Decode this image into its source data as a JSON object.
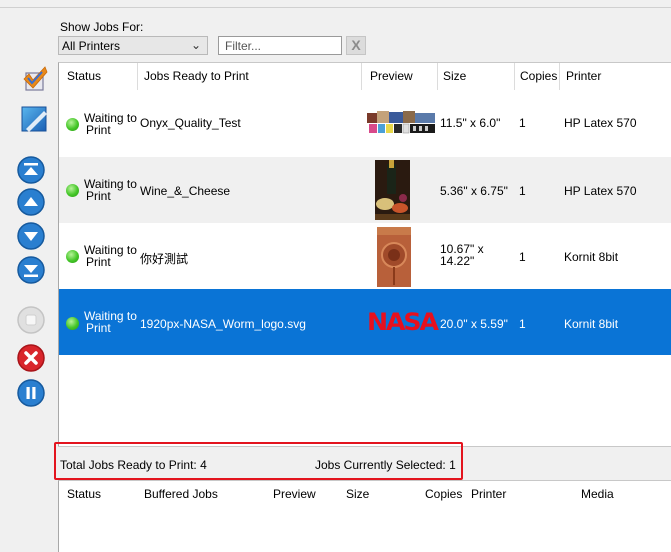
{
  "filter_bar": {
    "show_jobs_label": "Show Jobs For:",
    "printer_selected": "All Printers",
    "filter_placeholder": "Filter...",
    "clear_label": "X"
  },
  "jobs_table": {
    "columns": [
      "Status",
      "Jobs Ready to Print",
      "Preview",
      "Size",
      "Copies",
      "Printer"
    ],
    "rows": [
      {
        "status_line1": "Waiting to",
        "status_line2": "Print",
        "name": "Onyx_Quality_Test",
        "size_line1": "11.5\" x 6.0\"",
        "size_line2": "",
        "copies": "1",
        "printer": "HP Latex 570"
      },
      {
        "status_line1": "Waiting to",
        "status_line2": "Print",
        "name": "Wine_&_Cheese",
        "size_line1": "5.36\" x 6.75\"",
        "size_line2": "",
        "copies": "1",
        "printer": "HP Latex 570"
      },
      {
        "status_line1": "Waiting to",
        "status_line2": "Print",
        "name": "你好測試",
        "size_line1": "10.67\" x",
        "size_line2": "14.22\"",
        "copies": "1",
        "printer": "Kornit 8bit"
      },
      {
        "status_line1": "Waiting to",
        "status_line2": "Print",
        "name": "1920px-NASA_Worm_logo.svg",
        "size_line1": "20.0\" x 5.59\"",
        "size_line2": "",
        "copies": "1",
        "printer": "Kornit 8bit",
        "preview_text": "NASA"
      }
    ]
  },
  "status_bar": {
    "total_jobs": "Total Jobs Ready to Print: 4",
    "selected_jobs": "Jobs Currently Selected: 1"
  },
  "buffered_table": {
    "columns": [
      "Status",
      "Buffered Jobs",
      "Preview",
      "Size",
      "Copies",
      "Printer",
      "Media"
    ]
  },
  "toolbar_icons": [
    "approve-icon",
    "edit-icon",
    "move-top-icon",
    "move-up-icon",
    "move-down-icon",
    "move-bottom-icon",
    "disabled-icon",
    "delete-icon",
    "pause-icon"
  ],
  "colors": {
    "selection": "#0a74d6",
    "status_ok": "#44c628",
    "highlight_box": "#e3141e",
    "nav_blue": "#2a7fd0",
    "delete_red": "#d9252b"
  }
}
